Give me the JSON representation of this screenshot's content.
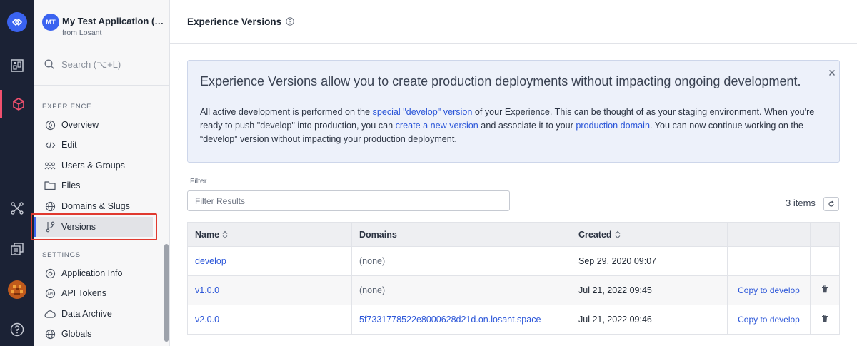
{
  "app": {
    "initials": "MT",
    "name": "My Test Application (Lo...",
    "org": "from Losant"
  },
  "search": {
    "placeholder": "Search (⌥+L)"
  },
  "sidebar": {
    "experience_label": "EXPERIENCE",
    "experience_items": [
      {
        "label": "Overview",
        "icon": "overview-icon"
      },
      {
        "label": "Edit",
        "icon": "code-icon"
      },
      {
        "label": "Users & Groups",
        "icon": "users-icon"
      },
      {
        "label": "Files",
        "icon": "folder-icon"
      },
      {
        "label": "Domains & Slugs",
        "icon": "globe-icon"
      },
      {
        "label": "Versions",
        "icon": "branch-icon",
        "selected": true
      }
    ],
    "settings_label": "SETTINGS",
    "settings_items": [
      {
        "label": "Application Info",
        "icon": "gear-icon"
      },
      {
        "label": "API Tokens",
        "icon": "api-icon"
      },
      {
        "label": "Data Archive",
        "icon": "cloud-icon"
      },
      {
        "label": "Globals",
        "icon": "globe-icon"
      }
    ]
  },
  "header": {
    "title": "Experience Versions"
  },
  "info": {
    "title": "Experience Versions allow you to create production deployments without impacting ongoing development.",
    "p1_a": "All active development is performed on the ",
    "p1_link": "special \"develop\" version",
    "p1_b": " of your Experience. This can be thought of as your staging environment. When you're ready to push \"develop\" into production, you can ",
    "p1_link2": "create a new version",
    "p1_c": " and associate it to your ",
    "p1_link3": "production domain",
    "p1_d": ". You can now continue working on the “develop” version without impacting your production deployment."
  },
  "filter": {
    "label": "Filter",
    "placeholder": "Filter Results"
  },
  "items_count": "3 items",
  "table": {
    "headers": {
      "name": "Name",
      "domains": "Domains",
      "created": "Created"
    },
    "rows": [
      {
        "name": "develop",
        "domains": "(none)",
        "created": "Sep 29, 2020 09:07",
        "action": ""
      },
      {
        "name": "v1.0.0",
        "domains": "(none)",
        "created": "Jul 21, 2022 09:45",
        "action": "Copy to develop"
      },
      {
        "name": "v2.0.0",
        "domains": "5f7331778522e8000628d21d.on.losant.space",
        "created": "Jul 21, 2022 09:46",
        "action": "Copy to develop"
      }
    ]
  },
  "colors": {
    "rail": "#1b2235",
    "accent": "#3a63f0",
    "link": "#2a55d8",
    "active_rail": "#f0506e",
    "highlight": "#e0392f"
  }
}
